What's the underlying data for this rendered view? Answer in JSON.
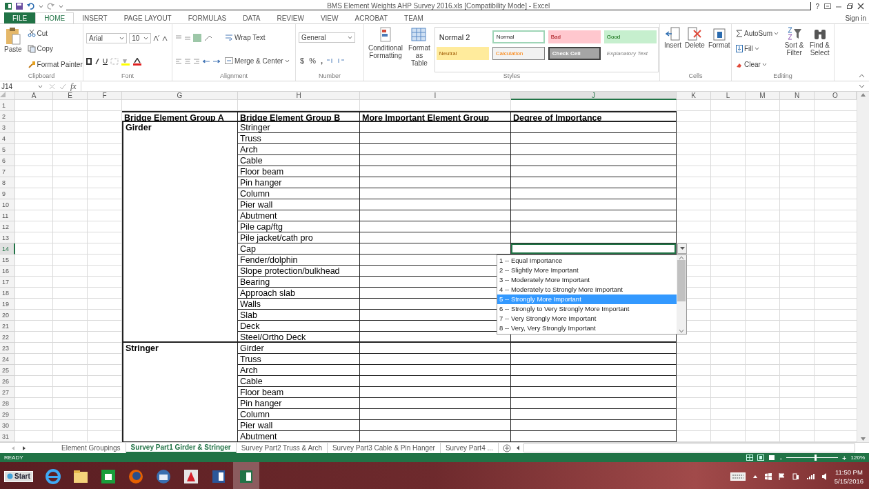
{
  "window": {
    "title": "BMS Element Weights AHP Survey 2016.xls  [Compatibility Mode] - Excel",
    "help": "?",
    "sign_in": "Sign in"
  },
  "ribbon_tabs": [
    {
      "label": "FILE",
      "kind": "file",
      "selected": false
    },
    {
      "label": "HOME",
      "kind": "tab",
      "selected": true
    },
    {
      "label": "INSERT",
      "kind": "tab",
      "selected": false
    },
    {
      "label": "PAGE LAYOUT",
      "kind": "tab",
      "selected": false
    },
    {
      "label": "FORMULAS",
      "kind": "tab",
      "selected": false
    },
    {
      "label": "DATA",
      "kind": "tab",
      "selected": false
    },
    {
      "label": "REVIEW",
      "kind": "tab",
      "selected": false
    },
    {
      "label": "VIEW",
      "kind": "tab",
      "selected": false
    },
    {
      "label": "ACROBAT",
      "kind": "tab",
      "selected": false
    },
    {
      "label": "TEAM",
      "kind": "tab",
      "selected": false
    }
  ],
  "clipboard": {
    "paste": "Paste",
    "cut": "Cut",
    "copy": "Copy",
    "format_painter": "Format Painter",
    "label": "Clipboard"
  },
  "font": {
    "name": "Arial",
    "size": "10",
    "label": "Font"
  },
  "alignment": {
    "wrap_text": "Wrap Text",
    "merge_center": "Merge & Center",
    "label": "Alignment"
  },
  "number": {
    "format": "General",
    "currency": "$",
    "percent": "%",
    "comma": ",",
    "label": "Number"
  },
  "styles": {
    "conditional_formatting": "Conditional Formatting",
    "format_as_table": "Format as Table",
    "label": "Styles",
    "cell_styles": [
      {
        "label": "Normal 2",
        "kind": "plain"
      },
      {
        "label": "Normal",
        "kind": "normal"
      },
      {
        "label": "Bad",
        "kind": "bad"
      },
      {
        "label": "Good",
        "kind": "good"
      },
      {
        "label": "Neutral",
        "kind": "neutral"
      },
      {
        "label": "Calculation",
        "kind": "calculation"
      },
      {
        "label": "Check Cell",
        "kind": "check"
      },
      {
        "label": "Explanatory Text",
        "kind": "explanatory"
      }
    ]
  },
  "cells": {
    "insert": "Insert",
    "delete": "Delete",
    "format": "Format",
    "label": "Cells"
  },
  "editing": {
    "autosum": "AutoSum",
    "fill": "Fill",
    "clear": "Clear",
    "sort_filter": "Sort & Filter",
    "find_select": "Find & Select",
    "label": "Editing"
  },
  "formula_bar": {
    "name_box": "J14",
    "fx": "fx"
  },
  "columns": [
    {
      "label": "A",
      "selected": false
    },
    {
      "label": "E",
      "selected": false
    },
    {
      "label": "F",
      "selected": false
    },
    {
      "label": "G",
      "selected": false
    },
    {
      "label": "H",
      "selected": false
    },
    {
      "label": "I",
      "selected": false
    },
    {
      "label": "J",
      "selected": true
    },
    {
      "label": "K",
      "selected": false
    },
    {
      "label": "L",
      "selected": false
    },
    {
      "label": "M",
      "selected": false
    },
    {
      "label": "N",
      "selected": false
    },
    {
      "label": "O",
      "selected": false
    }
  ],
  "row_numbers": [
    {
      "label": "1",
      "selected": false
    },
    {
      "label": "2",
      "selected": false
    },
    {
      "label": "3",
      "selected": false
    },
    {
      "label": "4",
      "selected": false
    },
    {
      "label": "5",
      "selected": false
    },
    {
      "label": "6",
      "selected": false
    },
    {
      "label": "7",
      "selected": false
    },
    {
      "label": "8",
      "selected": false
    },
    {
      "label": "9",
      "selected": false
    },
    {
      "label": "10",
      "selected": false
    },
    {
      "label": "11",
      "selected": false
    },
    {
      "label": "12",
      "selected": false
    },
    {
      "label": "13",
      "selected": false
    },
    {
      "label": "14",
      "selected": true
    },
    {
      "label": "15",
      "selected": false
    },
    {
      "label": "16",
      "selected": false
    },
    {
      "label": "17",
      "selected": false
    },
    {
      "label": "18",
      "selected": false
    },
    {
      "label": "19",
      "selected": false
    },
    {
      "label": "20",
      "selected": false
    },
    {
      "label": "21",
      "selected": false
    },
    {
      "label": "22",
      "selected": false
    },
    {
      "label": "23",
      "selected": false
    },
    {
      "label": "24",
      "selected": false
    },
    {
      "label": "25",
      "selected": false
    },
    {
      "label": "26",
      "selected": false
    },
    {
      "label": "27",
      "selected": false
    },
    {
      "label": "28",
      "selected": false
    },
    {
      "label": "29",
      "selected": false
    },
    {
      "label": "30",
      "selected": false
    },
    {
      "label": "31",
      "selected": false
    }
  ],
  "table": {
    "headers": [
      "Bridge Element Group A",
      "Bridge Element Group B",
      "More Important Element Group",
      "Degree of Importance"
    ],
    "groups": [
      {
        "name": "Girder",
        "items": [
          {
            "element": "Stringer",
            "selected": false
          },
          {
            "element": "Truss",
            "selected": false
          },
          {
            "element": "Arch",
            "selected": false
          },
          {
            "element": "Cable",
            "selected": false
          },
          {
            "element": "Floor beam",
            "selected": false
          },
          {
            "element": "Pin hanger",
            "selected": false
          },
          {
            "element": "Column",
            "selected": false
          },
          {
            "element": "Pier wall",
            "selected": false
          },
          {
            "element": "Abutment",
            "selected": false
          },
          {
            "element": "Pile cap/ftg",
            "selected": false
          },
          {
            "element": "Pile jacket/cath pro",
            "selected": false
          },
          {
            "element": "Cap",
            "selected": true
          },
          {
            "element": "Fender/dolphin",
            "selected": false
          },
          {
            "element": "Slope protection/bulkhead",
            "selected": false
          },
          {
            "element": "Bearing",
            "selected": false
          },
          {
            "element": "Approach slab",
            "selected": false
          },
          {
            "element": "Walls",
            "selected": false
          },
          {
            "element": "Slab",
            "selected": false
          },
          {
            "element": "Deck",
            "selected": false
          },
          {
            "element": "Steel/Ortho Deck",
            "selected": false
          }
        ]
      },
      {
        "name": "Stringer",
        "items": [
          {
            "element": "Girder",
            "selected": false
          },
          {
            "element": "Truss",
            "selected": false
          },
          {
            "element": "Arch",
            "selected": false
          },
          {
            "element": "Cable",
            "selected": false
          },
          {
            "element": "Floor beam",
            "selected": false
          },
          {
            "element": "Pin hanger",
            "selected": false
          },
          {
            "element": "Column",
            "selected": false
          },
          {
            "element": "Pier wall",
            "selected": false
          },
          {
            "element": "Abutment",
            "selected": false
          }
        ]
      }
    ]
  },
  "dropdown": {
    "options": [
      {
        "label": "1 -- Equal Importance",
        "selected": false
      },
      {
        "label": "2 -- Slightly More Important",
        "selected": false
      },
      {
        "label": "3 -- Moderately More Important",
        "selected": false
      },
      {
        "label": "4 -- Moderately to Strongly More Important",
        "selected": false
      },
      {
        "label": "5 -- Strongly More Important",
        "selected": true
      },
      {
        "label": "6 -- Strongly to Very Strongly More Important",
        "selected": false
      },
      {
        "label": "7 -- Very Strongly More Important",
        "selected": false
      },
      {
        "label": "8 -- Very, Very Strongly Important",
        "selected": false
      }
    ]
  },
  "sheet_tabs": [
    {
      "label": "Element Groupings",
      "selected": false
    },
    {
      "label": "Survey Part1 Girder & Stringer",
      "selected": true
    },
    {
      "label": "Survey Part2 Truss & Arch",
      "selected": false
    },
    {
      "label": "Survey Part3 Cable & Pin Hanger",
      "selected": false
    },
    {
      "label": "Survey Part4 ...",
      "selected": false
    }
  ],
  "status_bar": {
    "mode": "READY",
    "zoom_out": "-",
    "zoom_in": "+",
    "zoom": "120%",
    "zoom_slider": {
      "level": 0.55
    }
  },
  "taskbar": {
    "start": "Start",
    "apps": [
      {
        "kind": "ie",
        "selected": false
      },
      {
        "kind": "folder",
        "selected": false
      },
      {
        "kind": "store",
        "selected": false
      },
      {
        "kind": "firefox",
        "selected": false
      },
      {
        "kind": "thunderbird",
        "selected": false
      },
      {
        "kind": "acrobat",
        "selected": false
      },
      {
        "kind": "word",
        "selected": false
      },
      {
        "kind": "excel",
        "selected": true
      }
    ],
    "time": "11:50 PM",
    "date": "5/15/2016"
  }
}
